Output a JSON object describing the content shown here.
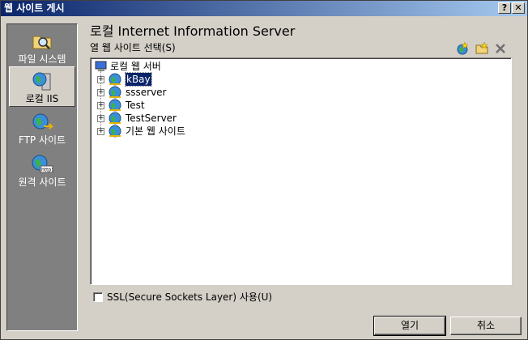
{
  "window": {
    "title": "웹 사이트 게시"
  },
  "titlebar_buttons": {
    "help": "?",
    "close": "✕"
  },
  "sidebar": {
    "items": [
      {
        "label": "파일 시스템",
        "icon": "folder-search-icon"
      },
      {
        "label": "로컬 IIS",
        "icon": "local-iis-icon",
        "selected": true
      },
      {
        "label": "FTP 사이트",
        "icon": "ftp-site-icon"
      },
      {
        "label": "원격 사이트",
        "icon": "remote-site-icon"
      }
    ]
  },
  "main": {
    "title": "로컬 Internet Information Server",
    "select_label": "열 웹 사이트 선택(S)"
  },
  "tree": {
    "root": "로컬 웹 서버",
    "nodes": [
      {
        "label": "kBay",
        "selected": true
      },
      {
        "label": "ssserver"
      },
      {
        "label": "Test"
      },
      {
        "label": "TestServer"
      },
      {
        "label": "기본 웹 사이트"
      }
    ]
  },
  "ssl": {
    "label": "SSL(Secure Sockets Layer) 사용(U)",
    "checked": false
  },
  "buttons": {
    "open": "열기",
    "cancel": "취소"
  },
  "colors": {
    "titlebar_start": "#0a246a",
    "titlebar_end": "#a6caf0",
    "dialog_bg": "#d4d0c8",
    "sidebar_bg": "#808080",
    "selection": "#0a246a"
  }
}
